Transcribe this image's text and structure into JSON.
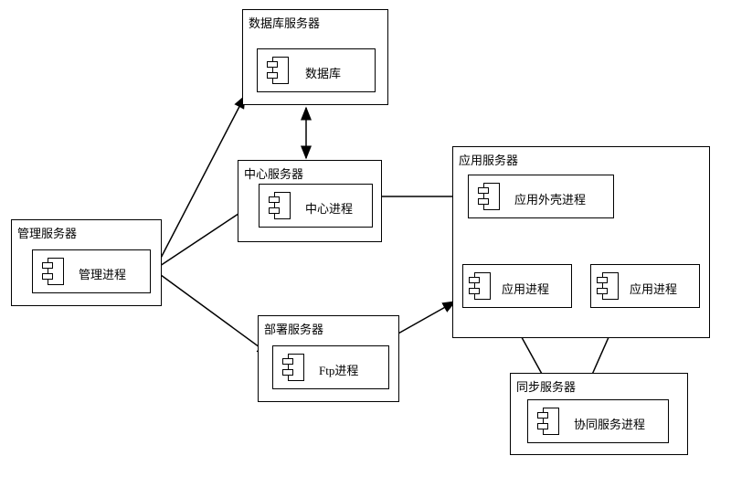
{
  "servers": {
    "database": {
      "title": "数据库服务器",
      "process": "数据库"
    },
    "center": {
      "title": "中心服务器",
      "process": "中心进程"
    },
    "management": {
      "title": "管理服务器",
      "process": "管理进程"
    },
    "deploy": {
      "title": "部署服务器",
      "process": "Ftp进程"
    },
    "application": {
      "title": "应用服务器",
      "shell_process": "应用外壳进程",
      "app_process_1": "应用进程",
      "app_process_2": "应用进程"
    },
    "sync": {
      "title": "同步服务器",
      "process": "协同服务进程"
    }
  }
}
